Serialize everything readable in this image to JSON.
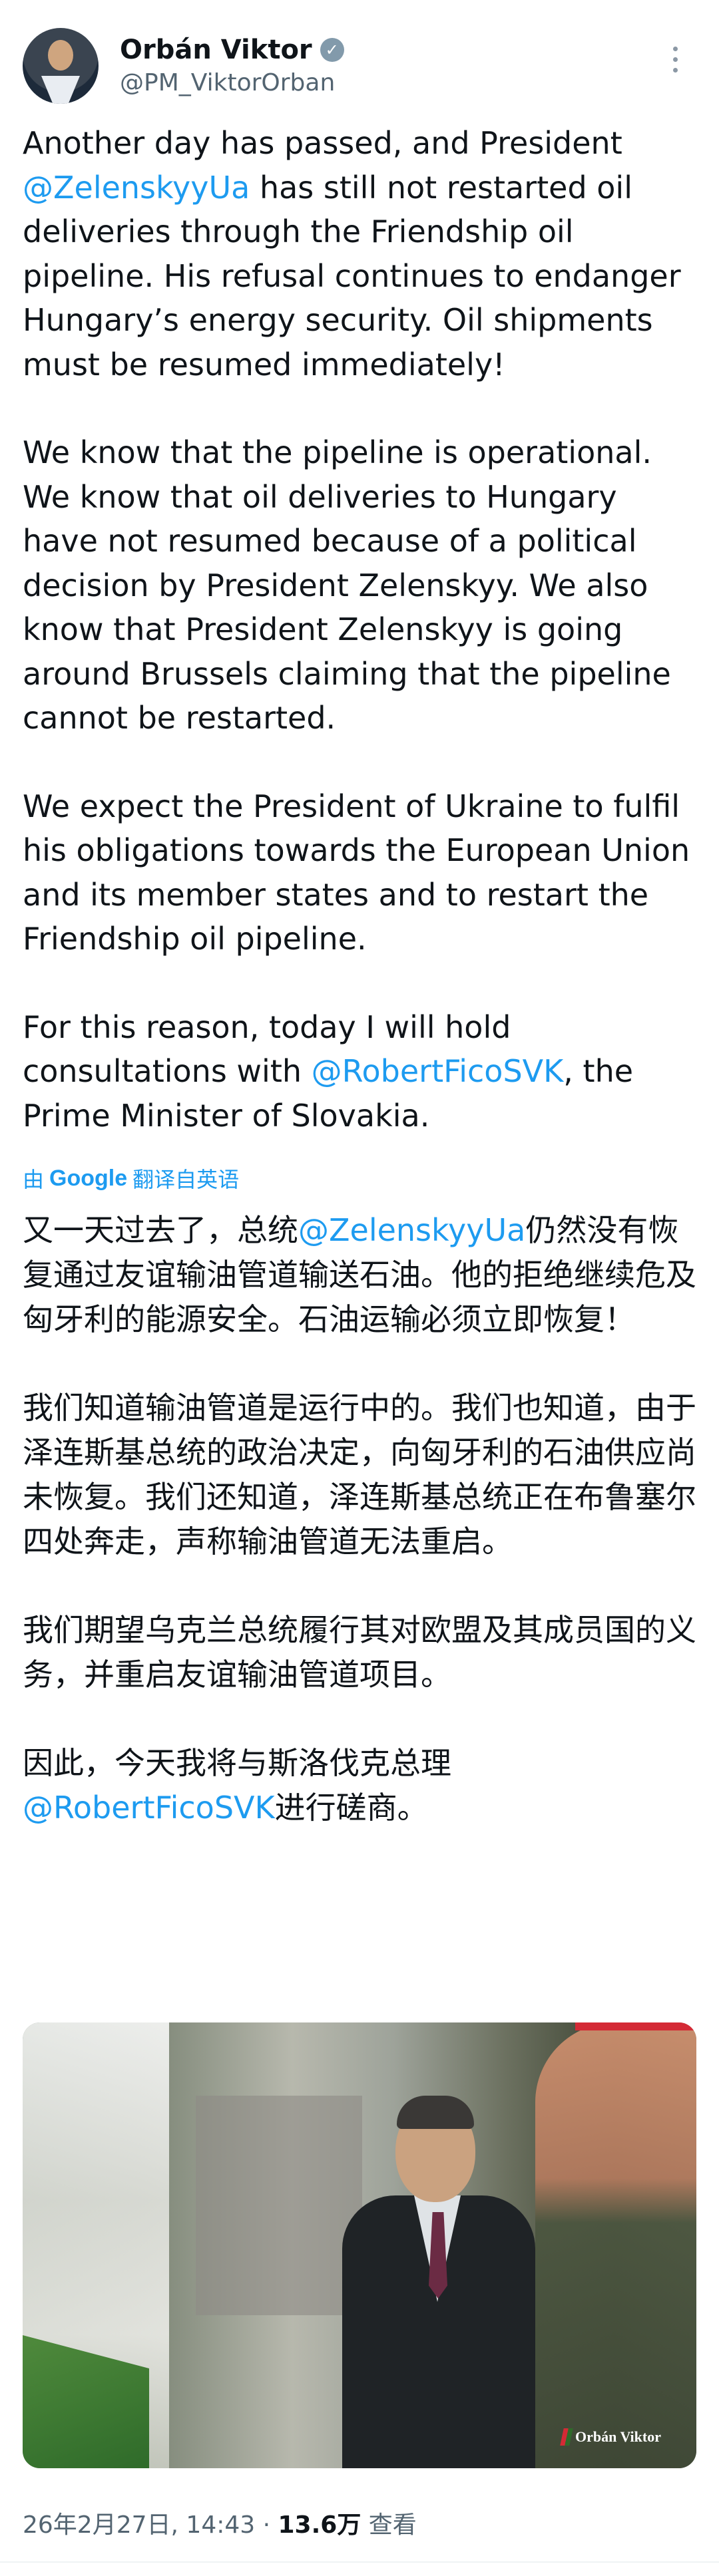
{
  "author": {
    "name": "Orbán Viktor",
    "handle": "@PM_ViktorOrban",
    "verified_icon": "check"
  },
  "tweet_en": {
    "p1_a": "Another day has passed, and President ",
    "p1_mention": "@ZelenskyyUa",
    "p1_b": " has still not restarted oil deliveries through the Friendship oil pipeline. His refusal continues to endanger Hungary’s energy security. Oil shipments must be resumed immediately!",
    "p2": "We know that the pipeline is operational. We know that oil deliveries to Hungary have not resumed because of a political decision by President Zelenskyy. We also know that President Zelenskyy is going around Brussels claiming that the pipeline cannot be restarted.",
    "p3": "We expect the President of Ukraine to fulfil his obligations towards the European Union and its member states and to restart the Friendship oil pipeline.",
    "p4_a": "For this reason, today I will hold consultations with ",
    "p4_mention": "@RobertFicoSVK",
    "p4_b": ", the Prime Minister of Slovakia."
  },
  "translation": {
    "prefix": "由",
    "provider": "Google",
    "suffix": "翻译自英语"
  },
  "tweet_zh": {
    "p1_a": "又一天过去了，总统",
    "p1_mention": "@ZelenskyyUa",
    "p1_b": "仍然没有恢复通过友谊输油管道输送石油。他的拒绝继续危及匈牙利的能源安全。石油运输必须立即恢复！",
    "p2": "我们知道输油管道是运行中的。我们也知道，由于泽连斯基总统的政治决定，向匈牙利的石油供应尚未恢复。我们还知道，泽连斯基总统正在布鲁塞尔四处奔走，声称输油管道无法重启。",
    "p3": "我们期望乌克兰总统履行其对欧盟及其成员国的义务，并重启友谊输油管道项目。",
    "p4_a": "因此，今天我将与斯洛伐克总理",
    "p4_mention": "@RobertFicoSVK",
    "p4_b": "进行磋商。"
  },
  "media": {
    "watermark": "Orbán Viktor"
  },
  "meta": {
    "timestamp": "26年2月27日, 14:43 · ",
    "views_count": "13.6万",
    "views_label": " 查看"
  }
}
